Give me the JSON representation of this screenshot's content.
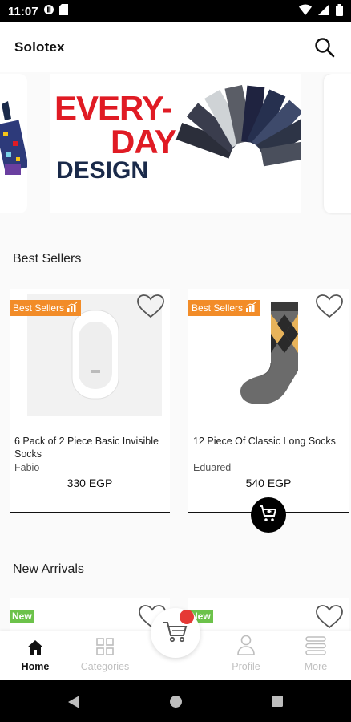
{
  "status": {
    "time": "11:07"
  },
  "app": {
    "title": "Solotex"
  },
  "banner": {
    "line1": "EVERY-",
    "line2": "DAY",
    "line3": "DESIGN"
  },
  "sections": {
    "best_sellers": "Best Sellers",
    "new_arrivals": "New Arrivals"
  },
  "products": [
    {
      "badge": "Best Sellers",
      "name": "6 Pack of 2 Piece Basic Invisible Socks",
      "brand": "Fabio",
      "price": "330 EGP"
    },
    {
      "badge": "Best Sellers",
      "name": "12 Piece Of Classic Long Socks",
      "brand": "Eduared",
      "price": "540 EGP"
    }
  ],
  "new_arrivals": [
    {
      "badge": "New"
    },
    {
      "badge": "New"
    }
  ],
  "nav": {
    "home": "Home",
    "categories": "Categories",
    "profile": "Profile",
    "more": "More"
  },
  "colors": {
    "badge": "#f28c28",
    "new_badge": "#6cc24a",
    "cart_dot": "#e53935",
    "banner_red": "#e01b24",
    "banner_navy": "#1a2a4a"
  }
}
